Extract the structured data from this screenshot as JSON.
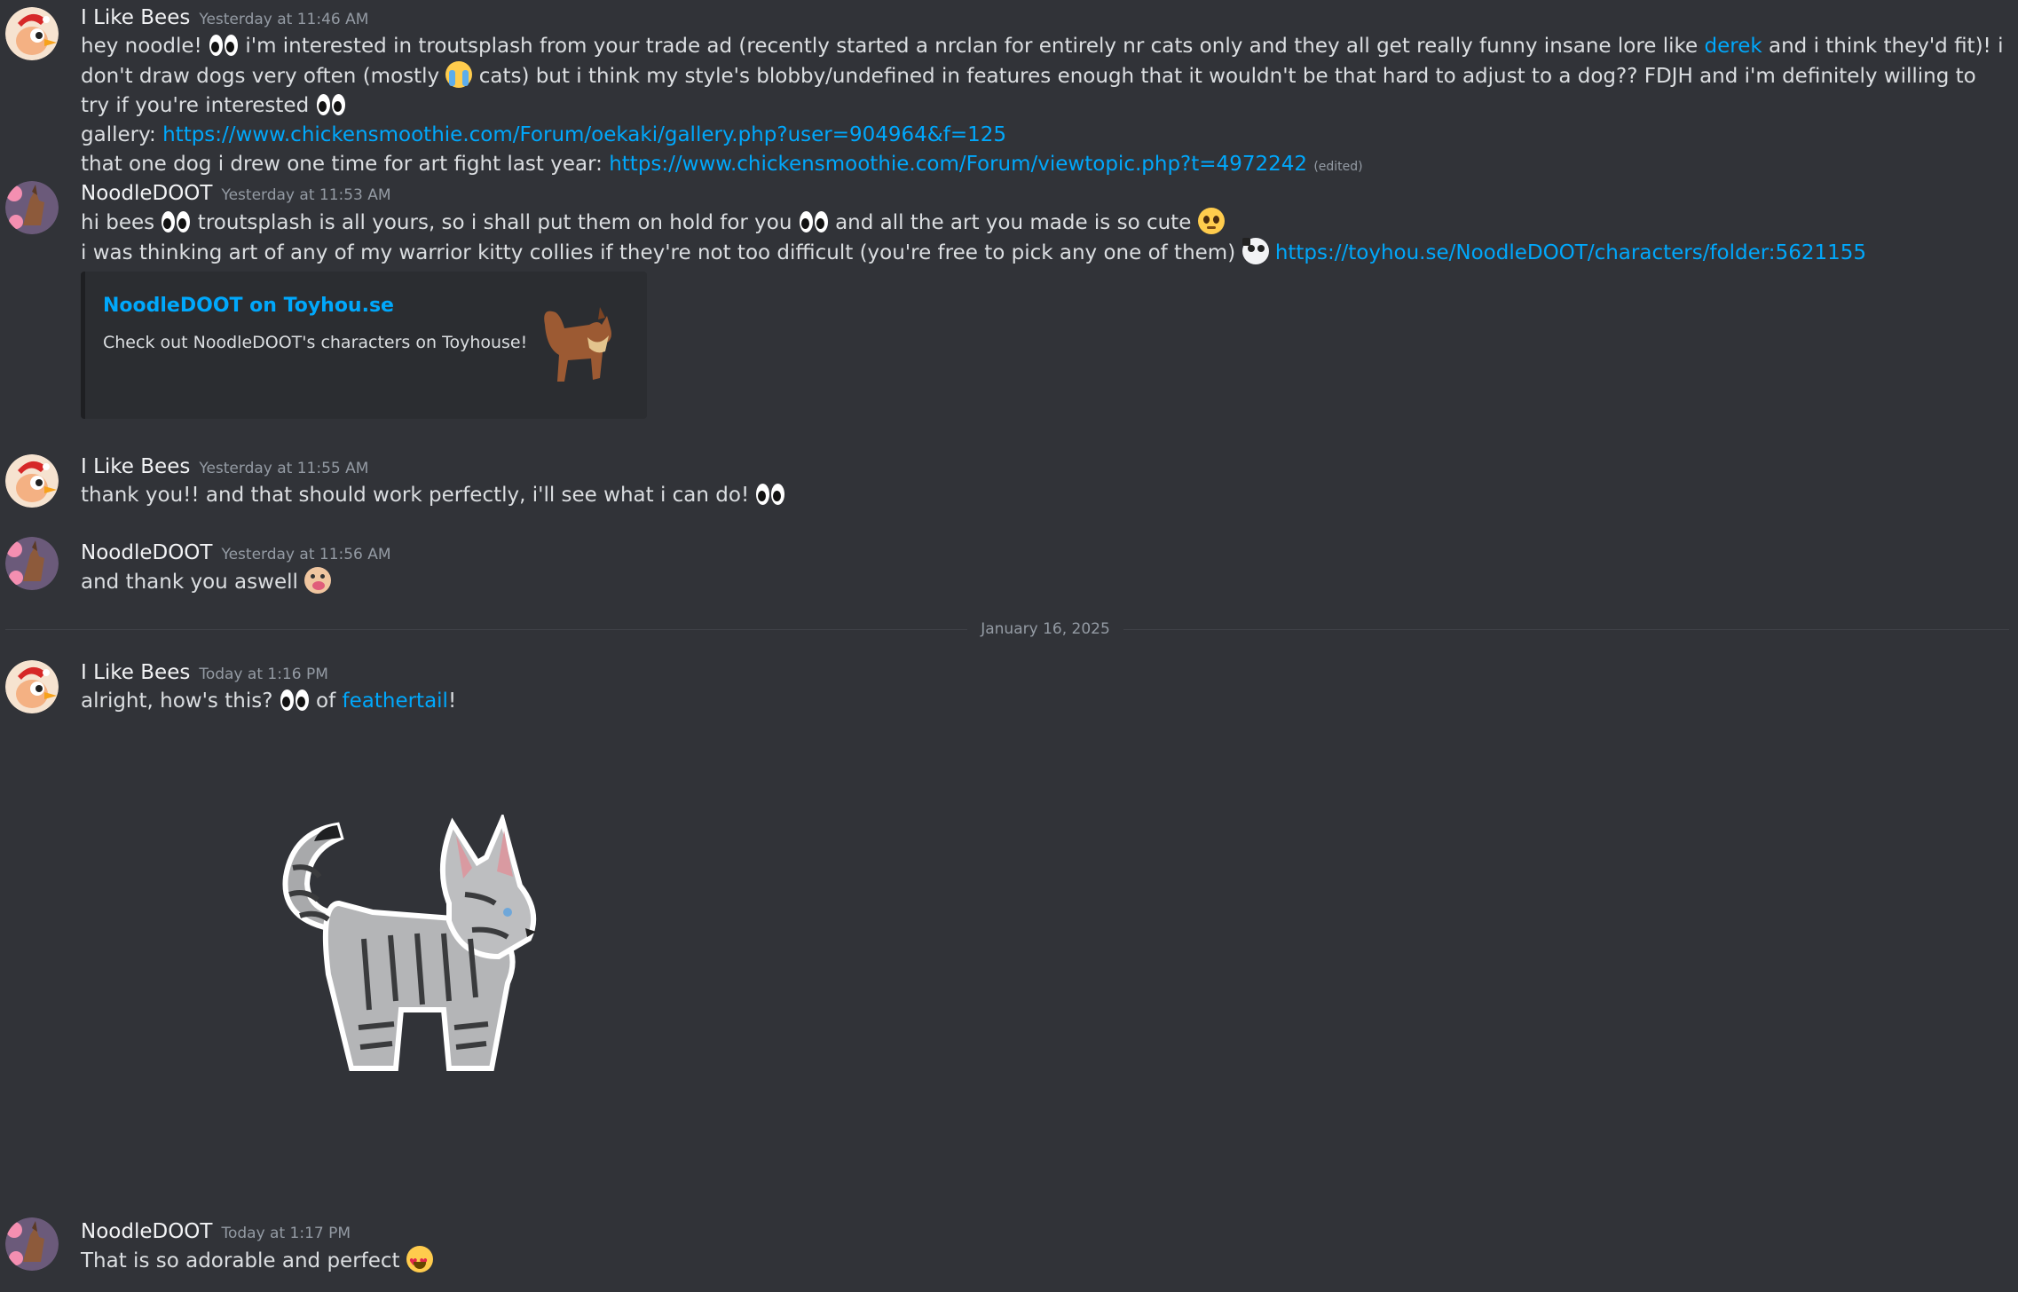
{
  "users": {
    "bees": "I Like Bees",
    "noodle": "NoodleDOOT"
  },
  "messages": [
    {
      "author": "I Like Bees",
      "timestamp": "Yesterday at 11:46 AM",
      "l1a": "hey noodle!",
      "l1b": "i'm interested in troutsplash from your trade ad (recently started a nrclan for entirely nr cats only and they all get really funny insane lore like",
      "l1link": "derek",
      "l1c": "and i think they'd fit)! i don't draw dogs very often",
      "l2a": "(mostly",
      "l2b": "cats) but i think my style's blobby/undefined in features enough that it wouldn't be that hard to adjust to a dog?? FDJH and i'm definitely willing to try if you're interested",
      "l3a": "gallery:",
      "l3link": "https://www.chickensmoothie.com/Forum/oekaki/gallery.php?user=904964&f=125",
      "l4a": "that one dog i drew one time for art fight last year:",
      "l4link": "https://www.chickensmoothie.com/Forum/viewtopic.php?t=4972242",
      "edited": "(edited)"
    },
    {
      "author": "NoodleDOOT",
      "timestamp": "Yesterday at 11:53 AM",
      "l1a": "hi bees",
      "l1b": "troutsplash is all yours, so i shall put them on hold for you",
      "l1c": "and all the art you made is so cute",
      "l2a": "i was thinking art of any of my warrior kitty collies if they're not too difficult (you're free to pick any one of them)",
      "l2link": "https://toyhou.se/NoodleDOOT/characters/folder:5621155",
      "embed": {
        "title": "NoodleDOOT on Toyhou.se",
        "description": "Check out NoodleDOOT's characters on Toyhouse!"
      }
    },
    {
      "author": "I Like Bees",
      "timestamp": "Yesterday at 11:55 AM",
      "l1a": "thank you!! and that should work perfectly, i'll see what i can do!"
    },
    {
      "author": "NoodleDOOT",
      "timestamp": "Yesterday at 11:56 AM",
      "l1a": "and thank you aswell"
    },
    {
      "author": "I Like Bees",
      "timestamp": "Today at 1:16 PM",
      "l1a": "alright, how's this?",
      "l1b": "of",
      "l1link": "feathertail",
      "l1c": "!"
    },
    {
      "author": "NoodleDOOT",
      "timestamp": "Today at 1:17 PM",
      "l1a": "That is so adorable and perfect"
    }
  ],
  "date_divider": "January 16, 2025",
  "colors": {
    "background": "#313338",
    "text": "#dbdee1",
    "link": "#00a8fc",
    "timestamp": "#949ba4",
    "embed_bg": "#2b2d31"
  },
  "icons": {
    "eyes": "eyes-emoji",
    "sob": "loudly-crying-emoji",
    "pleading": "pleading-face-emoji",
    "cat": "cat-emote",
    "hug": "hug-emote",
    "love": "smiling-face-with-hearts-emoji"
  }
}
